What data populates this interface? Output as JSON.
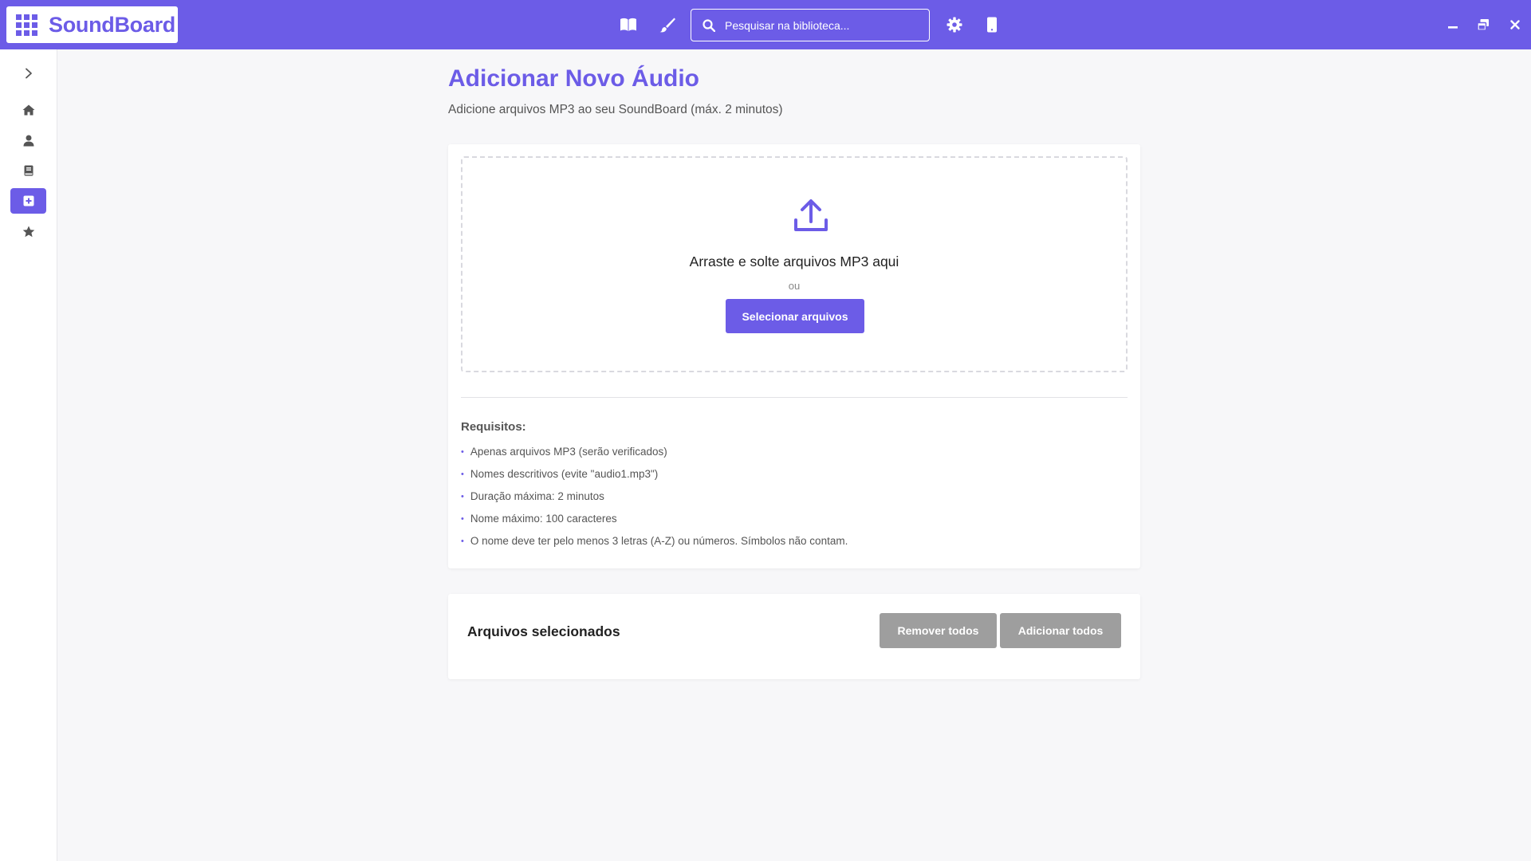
{
  "app": {
    "name": "SoundBoard"
  },
  "topbar": {
    "search_placeholder": "Pesquisar na biblioteca...",
    "icons": [
      "book-icon",
      "brush-icon",
      "search-icon",
      "gear-icon",
      "mobile-icon"
    ],
    "window_controls": [
      "minimize-icon",
      "restore-icon",
      "close-icon"
    ]
  },
  "sidebar": {
    "items": [
      {
        "icon": "chevron-right-icon",
        "active": false
      },
      {
        "icon": "home-icon",
        "active": false
      },
      {
        "icon": "user-icon",
        "active": false
      },
      {
        "icon": "book-icon",
        "active": false
      },
      {
        "icon": "plus-square-icon",
        "active": true
      },
      {
        "icon": "star-icon",
        "active": false
      }
    ]
  },
  "main": {
    "title": "Adicionar Novo Áudio",
    "subtitle": "Adicione arquivos MP3 ao seu SoundBoard (máx. 2 minutos)"
  },
  "upload": {
    "drop_title": "Arraste e solte arquivos MP3 aqui",
    "or_label": "ou",
    "select_button": "Selecionar arquivos"
  },
  "requirements": {
    "title": "Requisitos:",
    "items": [
      "Apenas arquivos MP3 (serão verificados)",
      "Nomes descritivos (evite \"audio1.mp3\")",
      "Duração máxima: 2 minutos",
      "Nome máximo: 100 caracteres",
      "O nome deve ter pelo menos 3 letras (A-Z) ou números. Símbolos não contam."
    ]
  },
  "selected": {
    "title": "Arquivos selecionados",
    "remove_all": "Remover todos",
    "add_all": "Adicionar todos"
  },
  "colors": {
    "accent": "#6c5ce7",
    "disabled_button": "#9e9e9e",
    "background": "#f7f7f9"
  }
}
